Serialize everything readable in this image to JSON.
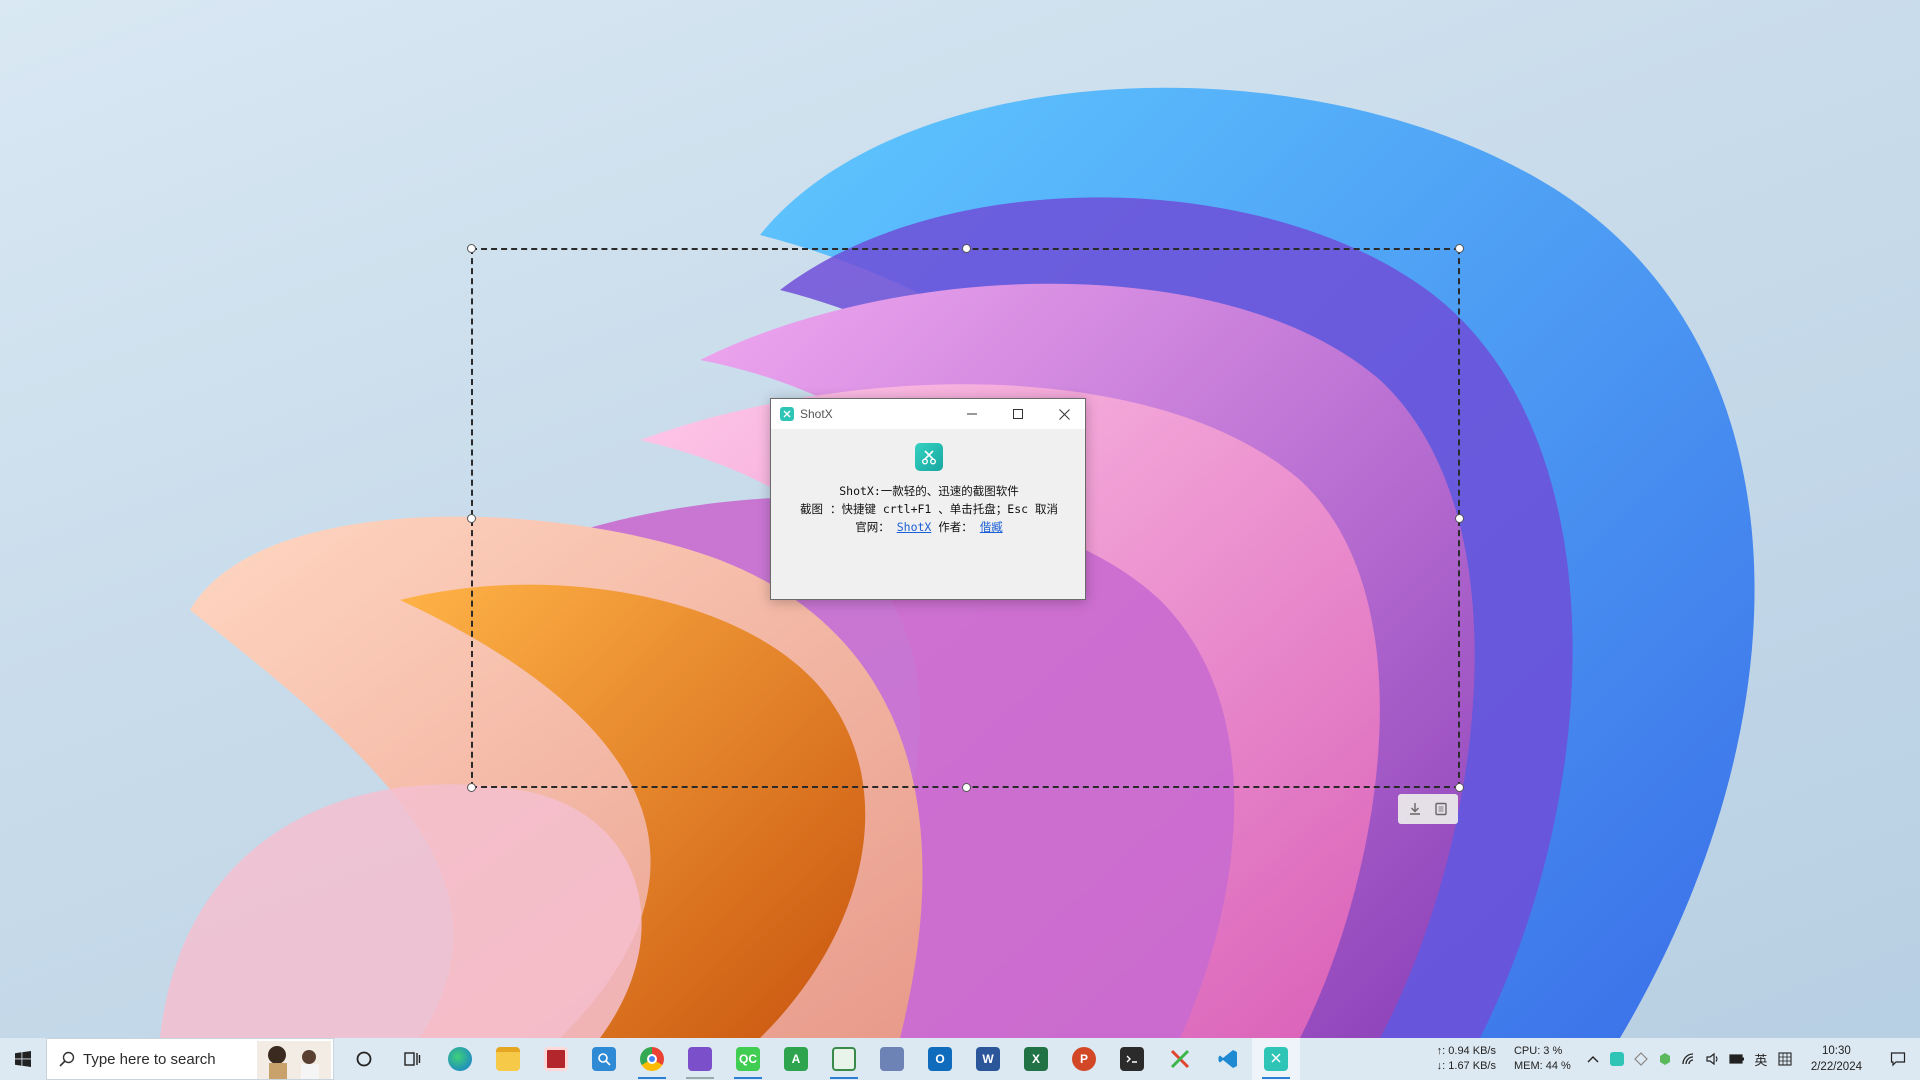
{
  "shotx": {
    "window_title": "ShotX",
    "line1": "ShotX:一款轻的、迅速的截图软件",
    "line2": "截图 ：快捷键 crtl+F1 、单击托盘；Esc 取消",
    "line3_label": "官网：",
    "website_link": "ShotX",
    "author_label": "作者：",
    "author_link": "偕臧"
  },
  "taskbar": {
    "search_placeholder": "Type here to search",
    "apps": [
      {
        "name": "cortana-icon"
      },
      {
        "name": "task-view-icon"
      },
      {
        "name": "edge-icon"
      },
      {
        "name": "file-explorer-icon"
      },
      {
        "name": "app-red-icon"
      },
      {
        "name": "app-blue-search-icon"
      },
      {
        "name": "chrome-icon"
      },
      {
        "name": "visual-studio-icon"
      },
      {
        "name": "qt-creator-icon",
        "label": "QC"
      },
      {
        "name": "app-green-icon",
        "label": "A"
      },
      {
        "name": "notepad-icon"
      },
      {
        "name": "app-network-icon"
      },
      {
        "name": "outlook-icon",
        "label": "O"
      },
      {
        "name": "word-icon",
        "label": "W"
      },
      {
        "name": "excel-icon",
        "label": "X"
      },
      {
        "name": "powerpoint-icon",
        "label": "P"
      },
      {
        "name": "terminal-icon"
      },
      {
        "name": "app-x-icon"
      },
      {
        "name": "vscode-icon"
      },
      {
        "name": "shotx-icon"
      }
    ],
    "net_up": "↑: 0.94 KB/s",
    "net_down": "↓: 1.67 KB/s",
    "cpu": "CPU: 3 %",
    "mem": "MEM: 44 %",
    "ime": "英",
    "time": "10:30",
    "date": "2/22/2024"
  },
  "colors": {
    "accent": "#2b7fd4",
    "shotx_teal": "#2ec4b6",
    "link": "#1a5fd6"
  }
}
